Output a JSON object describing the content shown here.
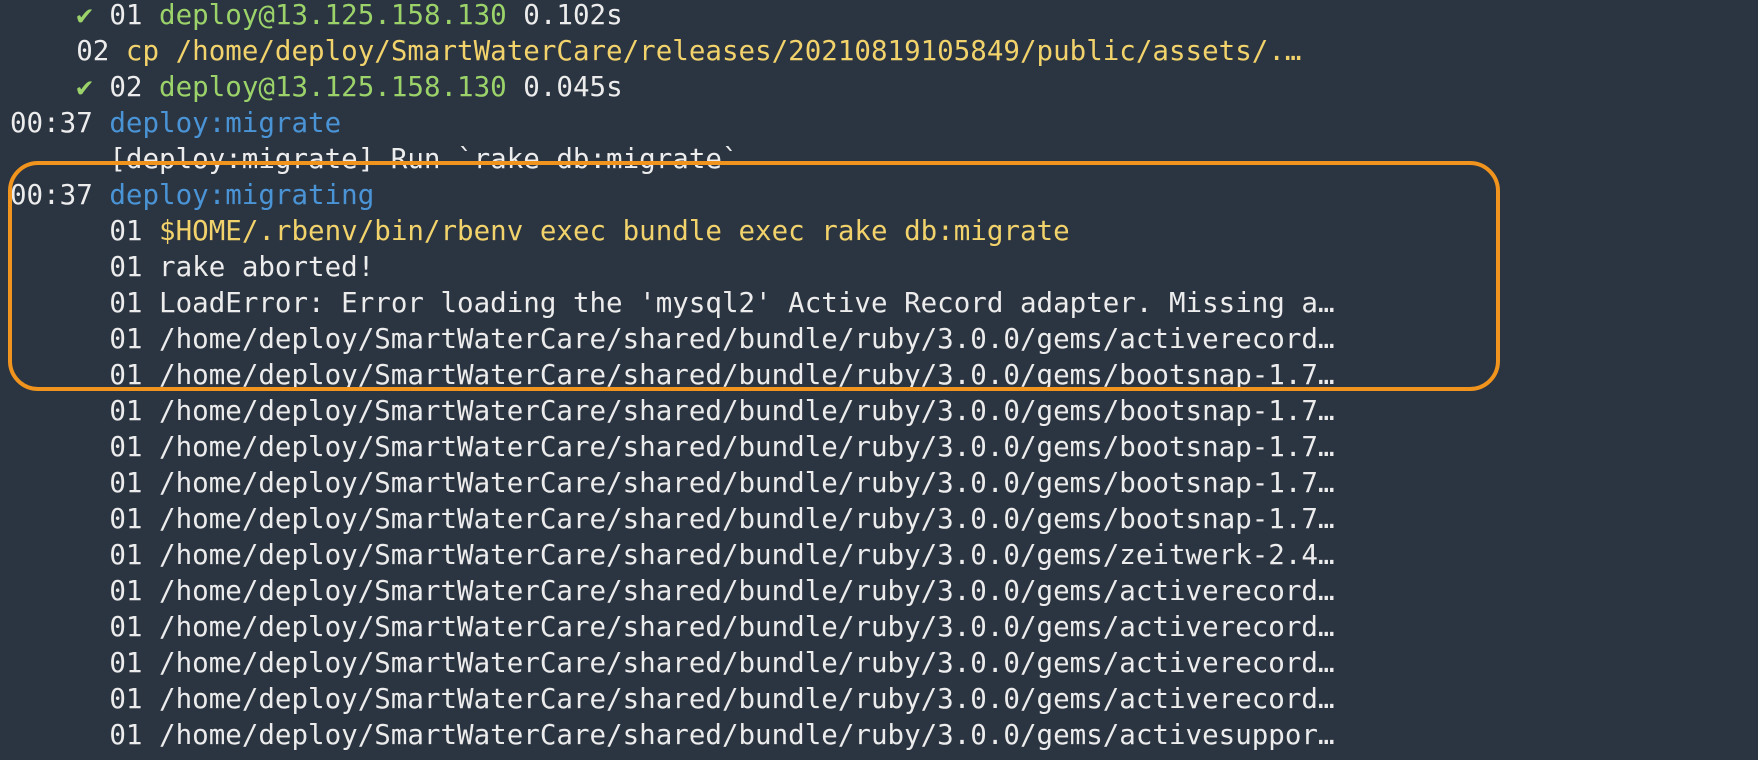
{
  "terminal": {
    "lines": [
      {
        "indent": "    ",
        "check": "✔ ",
        "num": "01",
        "host": "deploy@13.125.158.130",
        "dur": "0.102s"
      },
      {
        "indent": "    ",
        "num": "02",
        "cmd": "cp /home/deploy/SmartWaterCare/releases/20210819105849/public/assets/.…"
      },
      {
        "indent": "    ",
        "check": "✔ ",
        "num": "02",
        "host": "deploy@13.125.158.130",
        "dur": "0.045s"
      },
      {
        "time": "00:37",
        "task": "deploy:migrate"
      },
      {
        "indent": "      ",
        "out": "[deploy:migrate] Run `rake db:migrate`"
      },
      {
        "time": "00:37",
        "task": "deploy:migrating"
      },
      {
        "indent": "      ",
        "num": "01",
        "cmd": "$HOME/.rbenv/bin/rbenv exec bundle exec rake db:migrate"
      },
      {
        "indent": "      ",
        "num": "01",
        "out": "rake aborted!"
      },
      {
        "indent": "      ",
        "num": "01",
        "out": "LoadError: Error loading the 'mysql2' Active Record adapter. Missing a…"
      },
      {
        "indent": "      ",
        "num": "01",
        "out": "/home/deploy/SmartWaterCare/shared/bundle/ruby/3.0.0/gems/activerecord…"
      },
      {
        "indent": "      ",
        "num": "01",
        "out": "/home/deploy/SmartWaterCare/shared/bundle/ruby/3.0.0/gems/bootsnap-1.7…"
      },
      {
        "indent": "      ",
        "num": "01",
        "out": "/home/deploy/SmartWaterCare/shared/bundle/ruby/3.0.0/gems/bootsnap-1.7…"
      },
      {
        "indent": "      ",
        "num": "01",
        "out": "/home/deploy/SmartWaterCare/shared/bundle/ruby/3.0.0/gems/bootsnap-1.7…"
      },
      {
        "indent": "      ",
        "num": "01",
        "out": "/home/deploy/SmartWaterCare/shared/bundle/ruby/3.0.0/gems/bootsnap-1.7…"
      },
      {
        "indent": "      ",
        "num": "01",
        "out": "/home/deploy/SmartWaterCare/shared/bundle/ruby/3.0.0/gems/bootsnap-1.7…"
      },
      {
        "indent": "      ",
        "num": "01",
        "out": "/home/deploy/SmartWaterCare/shared/bundle/ruby/3.0.0/gems/zeitwerk-2.4…"
      },
      {
        "indent": "      ",
        "num": "01",
        "out": "/home/deploy/SmartWaterCare/shared/bundle/ruby/3.0.0/gems/activerecord…"
      },
      {
        "indent": "      ",
        "num": "01",
        "out": "/home/deploy/SmartWaterCare/shared/bundle/ruby/3.0.0/gems/activerecord…"
      },
      {
        "indent": "      ",
        "num": "01",
        "out": "/home/deploy/SmartWaterCare/shared/bundle/ruby/3.0.0/gems/activerecord…"
      },
      {
        "indent": "      ",
        "num": "01",
        "out": "/home/deploy/SmartWaterCare/shared/bundle/ruby/3.0.0/gems/activerecord…"
      },
      {
        "indent": "      ",
        "num": "01",
        "out": "/home/deploy/SmartWaterCare/shared/bundle/ruby/3.0.0/gems/activesuppor…"
      }
    ],
    "colors": {
      "background": "#2b3441",
      "task": "#4a94d6",
      "success": "#9bd36a",
      "command": "#f2d36b",
      "text": "#ececec",
      "highlight": "#f0941d"
    }
  }
}
